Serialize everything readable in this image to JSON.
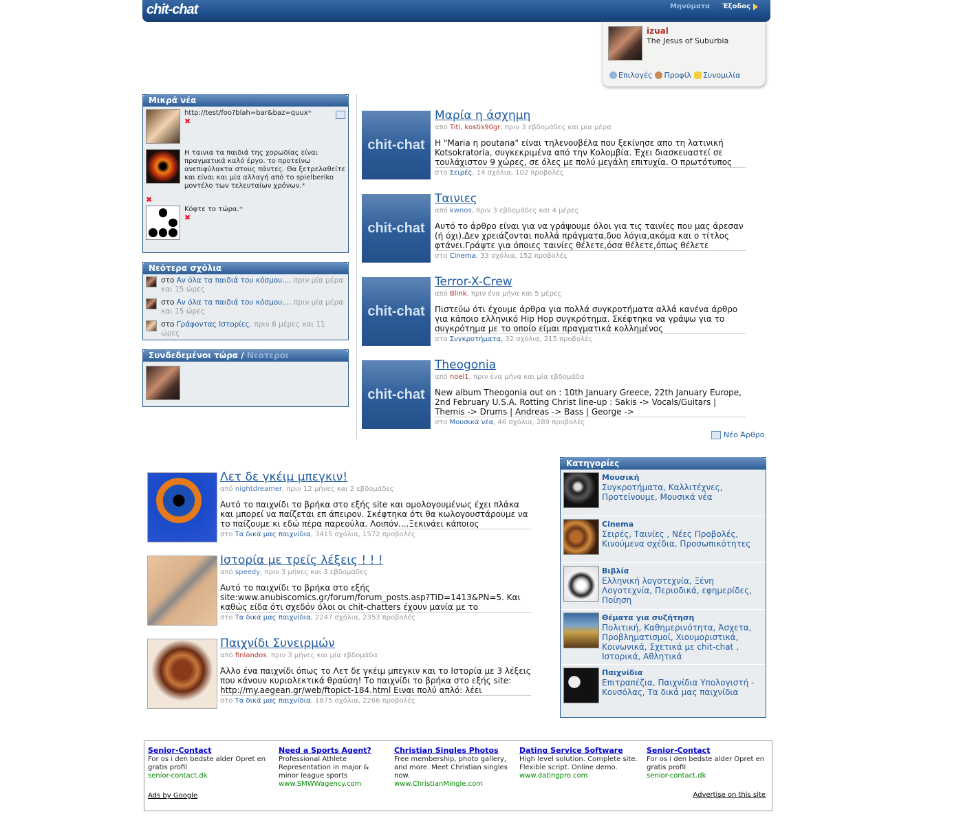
{
  "header": {
    "logo": "chit-chat",
    "messages": "Μηνύματα",
    "logout": "Έξοδος"
  },
  "user": {
    "name": "izual",
    "tagline": "The Jesus of Suburbia",
    "links": {
      "options": "Επιλογές",
      "profile": "Προφίλ",
      "chat": "Συνομιλία"
    }
  },
  "short_news": {
    "title": "Μικρά νέα",
    "items": [
      {
        "text": "http://test/foo?blah=bar&baz=quux",
        "star": "*"
      },
      {
        "text": "Η ταινια τα παιδιά της χορωδίας είναι πραγματικά καλό έργο. το προτείνω ανεπιφύλακτα στους πάντες. Θα ξετρελαθείτε και είναι και μία αλλαγή από το spielberiko μοντέλο των τελευταίων χρόνων.",
        "star": "*"
      },
      {
        "text": "Κόφτε το τώρα.",
        "star": "*"
      }
    ]
  },
  "latest_comments": {
    "title": "Νεότερα σχόλια",
    "items": [
      {
        "prefix": "στο",
        "link": "Αν όλα τα παιδιά του κόσμου...",
        "time": ", πριν μία μέρα και 15 ώρες"
      },
      {
        "prefix": "στο",
        "link": "Αν όλα τα παιδιά του κόσμου...",
        "time": ", πριν μία μέρα και 15 ώρες"
      },
      {
        "prefix": "στο",
        "link": "Γράφοντας Ιστορίες",
        "time": ", πριν 6 μέρες και 11 ώρες"
      }
    ]
  },
  "online": {
    "title": "Συνδεδεμένοι τώρα",
    "sep": " / ",
    "newest": "Νεότεροι"
  },
  "articles": [
    {
      "thumb": "chit-chat",
      "title": "Μαρία η άσχημη",
      "by": "από",
      "authors": "Titi, kostis90gr",
      "time": ", πριν 3 εβδομάδες και μία μέρα",
      "body": "Η \"Maria η poutana\" είναι τηλενουβέλα που ξεκίνησε απο τη λατινική Kotsokratoria, συγκεκριμένα από την Κολομβία. Έχει διασκευαστεί σε τουλάχιστον 9 χώρες, σε όλες με πολύ μεγάλη επιτυχία. Ο πρωτότυπος",
      "in": "στο",
      "cat": "Σειρές",
      "stats": ", 14 σχόλια, 102 προβολές"
    },
    {
      "thumb": "chit-chat",
      "title": "Ταινιες",
      "by": "από",
      "authors": "kwnos",
      "time": ", πριν 3 εβδομάδες και 4 μέρες",
      "body": "Αυτό το άρθρο είναι για να γράψουμε όλοι για τις ταινίες που μας άρεσαν (ή όχι).Δεν χρειάζονται πολλά πράγματα,δυο λόγια,ακόμα και ο τίτλος φτάνει.Γράψτε για όποιες ταινίες θέλετε,όσα θέλετε,όπως θέλετε",
      "in": "στο",
      "cat": "Cinema",
      "stats": ", 33 σχόλια, 152 προβολές"
    },
    {
      "thumb": "chit-chat",
      "title": "Terror-X-Crew",
      "by": "από",
      "authors": "Blink",
      "time": ", πριν ένα μήνα και 5 μέρες",
      "body": "Πιστεύω ότι έχουμε άρθρα για πολλά συγκροτήματα αλλά κανένα άρθρο για κάποιο ελληνικό Hip Hop συγκρότημα. Σκέφτηκα να γράψω για το συγκρότημα με το οποίο είμαι πραγματικά κολλημένος",
      "in": "στο",
      "cat": "Συγκροτήματα",
      "stats": ", 32 σχόλια, 215 προβολές"
    },
    {
      "thumb": "chit-chat",
      "title": "Theogonia",
      "by": "από",
      "authors": "noel1",
      "time": ", πριν ένα μήνα και μία εβδομάδα",
      "body": "New album Theogonia out on : 10th January Greece, 22th January Europe, 2nd February U.S.A. Rotting Christ line-up : Sakis -> Vocals/Guitars | Themis -> Drums | Andreas -> Bass | George ->",
      "in": "στο",
      "cat": "Μουσικά νέα",
      "stats": ", 46 σχόλια, 289 προβολές"
    }
  ],
  "new_article": "Νέο Άρθρο",
  "games": [
    {
      "title": "Λετ δε γκέιμ μπεγκιν!",
      "by": "από",
      "authors": "nightdreamer",
      "time": ", πριν 12 μήνες και 2 εβδομάδες",
      "body": "Αυτό το παιχνίδι το βρήκα στο εξής site και ομολογουμένως έχει πλάκα και μπορεί να παίζεται επ άπειρον. Σκέφτηκα ότι θα κωλογουστάρουμε να το παίζουμε κι εδώ πέρα παρεούλα. Λοιπόν....Ξεκινάει κάποιος",
      "in": "στο",
      "cat": "Τα δικά μας παιχνίδια",
      "stats": ", 3415 σχόλια, 1572 προβολές"
    },
    {
      "title": "Ιστορία με τρείς λέξεις ! ! !",
      "by": "από",
      "authors": "speedy",
      "time": ", πριν 3 μήνες και 3 εβδομάδες",
      "body": "Αυτό το παιχνίδι το βρήκα στο εξής site:www.anubiscomics.gr/forum/forum_posts.asp?TID=1413&PN=5. Και καθώς είδα ότι σχεδόν όλοι οι chit-chatters έχουν μανία με το",
      "in": "στο",
      "cat": "Τα δικά μας παιχνίδια",
      "stats": ", 2247 σχόλια, 2353 προβολές"
    },
    {
      "title": "Παιχνίδι Συνειρμών",
      "by": "από",
      "authors": "finlandos",
      "time": ", πριν 3 μήνες και μία εβδομάδα",
      "body": "Άλλο ένα παιχνίδι όπως το Λετ δε γκέιμ μπεγκιν και το Ιστορία με 3 λέξεις που κάνουν κυριολεκτικά θραύση! Το παιχνίδι το βρήκα στο εξής site: http://my.aegean.gr/web/ftopict-184.html Ειναι πολύ απλό: λέει",
      "in": "στο",
      "cat": "Τα δικά μας παιχνίδια",
      "stats": ", 1875 σχόλια, 2266 προβολές"
    }
  ],
  "categories": {
    "title": "Κατηγορίες",
    "items": [
      {
        "name": "Μουσική",
        "links": "Συγκροτήματα, Καλλιτέχνες, Προτείνουμε, Μουσικά νέα"
      },
      {
        "name": "Cinema",
        "links": "Σειρές, Ταινίες , Νέες Προβολές, Κινούμενα σχέδια, Προσωπικότητες"
      },
      {
        "name": "Βιβλία",
        "links": "Ελληνική λογοτεχνία, Ξένη Λογοτεχνία, Περιοδικά, εφημερίδες, Ποίηση"
      },
      {
        "name": "Θέματα για συζήτηση",
        "links": "Πολιτική, Καθημερινότητα, Άσχετα, Προβληματισμοί, Χιουμοριστικά, Κοινωνικά, Σχετικά με chit-chat , Ιστορικά, Αθλητικά"
      },
      {
        "name": "Παιχνίδια",
        "links": "Επιτραπέζια, Παιχνίδια Υπολογιστή - Κονσόλας, Τα δικά μας παιχνίδια"
      }
    ]
  },
  "ads": {
    "items": [
      {
        "title": "Senior-Contact",
        "text": "For os i den bedste alder Opret en gratis profil",
        "url": "senior-contact.dk"
      },
      {
        "title": "Need a Sports Agent?",
        "text": "Professional Athlete Representation in major & minor league sports",
        "url": "www.SMWWagency.com"
      },
      {
        "title": "Christian Singles Photos",
        "text": "Free membership, photo gallery, and more. Meet Christian singles now.",
        "url": "www.ChristianMingle.com"
      },
      {
        "title": "Dating Service Software",
        "text": "High level solution. Complete site. Flexible script. Online demo.",
        "url": "www.datingpro.com"
      },
      {
        "title": "Senior-Contact",
        "text": "For os i den bedste alder Opret en gratis profil",
        "url": "senior-contact.dk"
      }
    ],
    "by_google": "Ads by Google",
    "advertise": "Advertise on this site"
  }
}
